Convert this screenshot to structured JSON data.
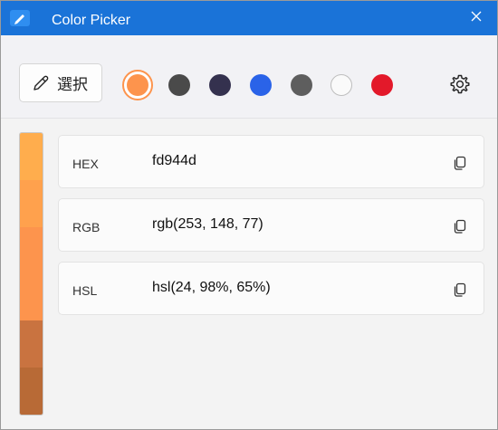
{
  "window": {
    "title": "Color Picker"
  },
  "toolbar": {
    "select_label": "選択",
    "swatches": [
      {
        "color": "#fd944d",
        "selected": true
      },
      {
        "color": "#4a4a4a"
      },
      {
        "color": "#34314e"
      },
      {
        "color": "#2a63e8"
      },
      {
        "color": "#5e5e5e"
      },
      {
        "color": "#fafafa"
      },
      {
        "color": "#e3192a"
      }
    ]
  },
  "gradient": [
    "#ffad4d",
    "#ffa14d",
    "#fd944d",
    "#fd944d",
    "#c97340",
    "#b86a36"
  ],
  "values": [
    {
      "label": "HEX",
      "value": "fd944d"
    },
    {
      "label": "RGB",
      "value": "rgb(253, 148, 77)"
    },
    {
      "label": "HSL",
      "value": "hsl(24, 98%, 65%)"
    }
  ]
}
